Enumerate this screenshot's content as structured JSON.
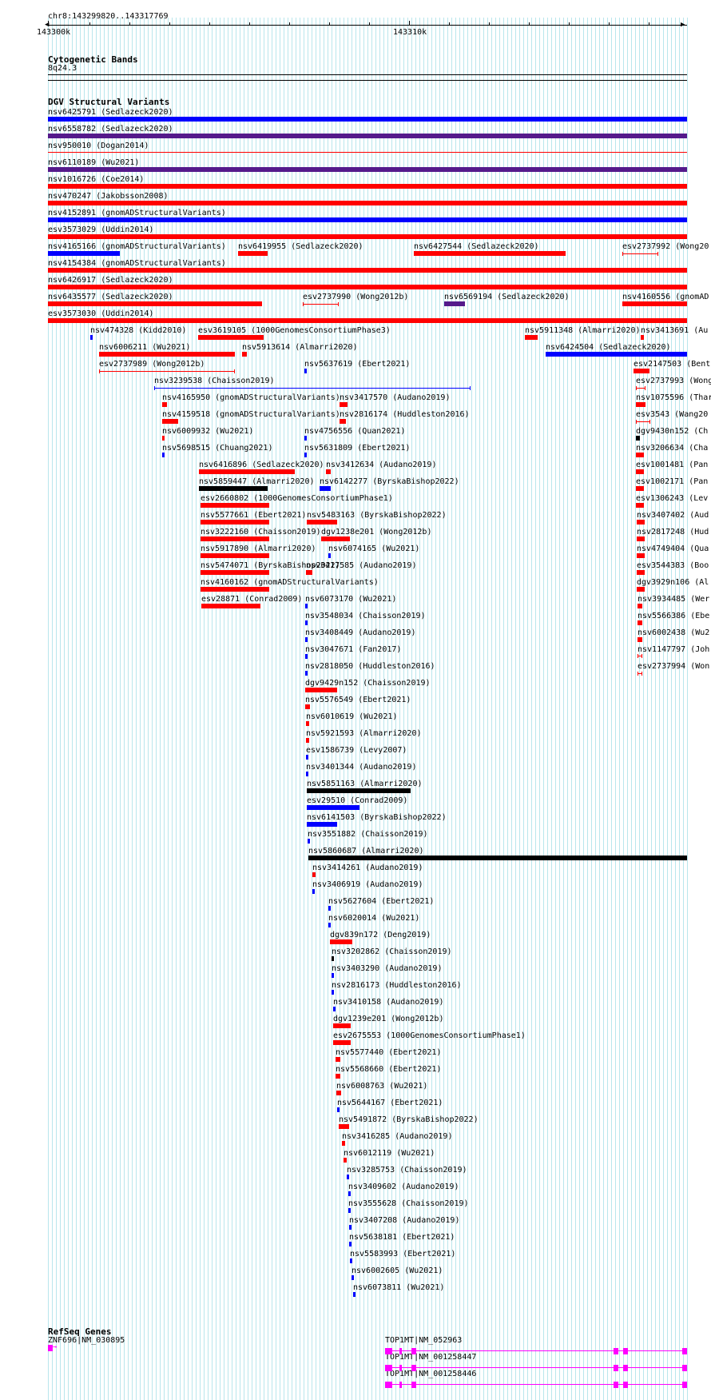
{
  "header": {
    "location": "chr8:143299820..143317769",
    "ruler_left": "143300k",
    "ruler_mid": "143310k"
  },
  "tracks": {
    "cytoband": {
      "title": "Cytogenetic Bands",
      "band": "8q24.3"
    },
    "dgv": {
      "title": "DGV Structural Variants"
    },
    "refseq": {
      "title": "RefSeq Genes"
    }
  },
  "colors": {
    "loss": "#ff0000",
    "gain": "#0000ff",
    "gain_loss": "#551a8b",
    "complex": "#000000",
    "gene": "#ff00ff",
    "grid": "#b9e6ec"
  },
  "variants": [
    {
      "label": "nsv6425791 (Sedlazeck2020)",
      "color": "#0000ff"
    },
    {
      "label": "nsv6558782 (Sedlazeck2020)",
      "color": "#551a8b"
    },
    {
      "label": "nsv950010 (Dogan2014)",
      "color": "#ff0000"
    },
    {
      "label": "nsv6110189 (Wu2021)",
      "color": "#551a8b"
    },
    {
      "label": "nsv1016726 (Coe2014)",
      "color": "#ff0000"
    },
    {
      "label": "nsv470247 (Jakobsson2008)",
      "color": "#ff0000"
    },
    {
      "label": "nsv4152891 (gnomADStructuralVariants)",
      "color": "#0000ff"
    },
    {
      "label": "esv3573029 (Uddin2014)",
      "color": "#ff0000"
    },
    {
      "label": "nsv4165166 (gnomADStructuralVariants)",
      "color": "#0000ff"
    },
    {
      "label": "nsv6419955 (Sedlazeck2020)",
      "color": "#ff0000"
    },
    {
      "label": "nsv6427544 (Sedlazeck2020)",
      "color": "#ff0000"
    },
    {
      "label": "esv2737992 (Wong20",
      "color": "#ff0000"
    },
    {
      "label": "nsv4154384 (gnomADStructuralVariants)",
      "color": "#ff0000"
    },
    {
      "label": "nsv6426917 (Sedlazeck2020)",
      "color": "#ff0000"
    },
    {
      "label": "nsv6435577 (Sedlazeck2020)",
      "color": "#ff0000"
    },
    {
      "label": "esv2737990 (Wong2012b)",
      "color": "#ff0000"
    },
    {
      "label": "nsv6569194 (Sedlazeck2020)",
      "color": "#551a8b"
    },
    {
      "label": "nsv4160556 (gnomAD",
      "color": "#ff0000"
    },
    {
      "label": "esv3573030 (Uddin2014)",
      "color": "#ff0000"
    },
    {
      "label": "nsv474328 (Kidd2010)",
      "color": "#0000ff"
    },
    {
      "label": "esv3619105 (1000GenomesConsortiumPhase3)",
      "color": "#ff0000"
    },
    {
      "label": "nsv5911348 (Almarri2020)",
      "color": "#ff0000"
    },
    {
      "label": "nsv3413691 (Au",
      "color": "#ff0000"
    },
    {
      "label": "nsv6006211 (Wu2021)",
      "color": "#ff0000"
    },
    {
      "label": "nsv5913614 (Almarri2020)",
      "color": "#ff0000"
    },
    {
      "label": "nsv6424504 (Sedlazeck2020)",
      "color": "#0000ff"
    },
    {
      "label": "esv2737989 (Wong2012b)",
      "color": "#ff0000"
    },
    {
      "label": "nsv5637619 (Ebert2021)",
      "color": "#0000ff"
    },
    {
      "label": "esv2147503 (Bent",
      "color": "#ff0000"
    },
    {
      "label": "nsv3239538 (Chaisson2019)",
      "color": "#0000ff"
    },
    {
      "label": "esv2737993 (Wong",
      "color": "#ff0000"
    },
    {
      "label": "nsv4165950 (gnomADStructuralVariants)",
      "color": "#ff0000"
    },
    {
      "label": "nsv3417570 (Audano2019)",
      "color": "#ff0000"
    },
    {
      "label": "nsv1075596 (Thar",
      "color": "#ff0000"
    },
    {
      "label": "nsv4159518 (gnomADStructuralVariants)",
      "color": "#ff0000"
    },
    {
      "label": "nsv2816174 (Huddleston2016)",
      "color": "#ff0000"
    },
    {
      "label": "esv3543 (Wang20",
      "color": "#ff0000"
    },
    {
      "label": "nsv6009932 (Wu2021)",
      "color": "#ff0000"
    },
    {
      "label": "nsv4756556 (Quan2021)",
      "color": "#0000ff"
    },
    {
      "label": "dgv9430n152 (Ch",
      "color": "#000000"
    },
    {
      "label": "nsv5698515 (Chuang2021)",
      "color": "#0000ff"
    },
    {
      "label": "nsv5631809 (Ebert2021)",
      "color": "#0000ff"
    },
    {
      "label": "nsv3206634 (Cha",
      "color": "#ff0000"
    },
    {
      "label": "nsv6416896 (Sedlazeck2020)",
      "color": "#ff0000"
    },
    {
      "label": "nsv3412634 (Audano2019)",
      "color": "#ff0000"
    },
    {
      "label": "esv1001481 (Pan",
      "color": "#ff0000"
    },
    {
      "label": "nsv5859447 (Almarri2020)",
      "color": "#000000"
    },
    {
      "label": "nsv6142277 (ByrskaBishop2022)",
      "color": "#0000ff"
    },
    {
      "label": "esv1002171 (Pan",
      "color": "#ff0000"
    },
    {
      "label": "esv2660802 (1000GenomesConsortiumPhase1)",
      "color": "#ff0000"
    },
    {
      "label": "esv1306243 (Lev",
      "color": "#ff0000"
    },
    {
      "label": "nsv5577661 (Ebert2021)",
      "color": "#ff0000"
    },
    {
      "label": "nsv5483163 (ByrskaBishop2022)",
      "color": "#ff0000"
    },
    {
      "label": "nsv3407402 (Aud",
      "color": "#ff0000"
    },
    {
      "label": "nsv3222160 (Chaisson2019)",
      "color": "#ff0000"
    },
    {
      "label": "dgv1238e201 (Wong2012b)",
      "color": "#ff0000"
    },
    {
      "label": "nsv2817248 (Hud",
      "color": "#ff0000"
    },
    {
      "label": "nsv5917890 (Almarri2020)",
      "color": "#ff0000"
    },
    {
      "label": "nsv6074165 (Wu2021)",
      "color": "#0000ff"
    },
    {
      "label": "nsv4749404 (Qua",
      "color": "#ff0000"
    },
    {
      "label": "nsv5474071 (ByrskaBishop2022)",
      "color": "#ff0000"
    },
    {
      "label": "nsv3417585 (Audano2019)",
      "color": "#ff0000"
    },
    {
      "label": "esv3544383 (Boo",
      "color": "#ff0000"
    },
    {
      "label": "nsv4160162 (gnomADStructuralVariants)",
      "color": "#ff0000"
    },
    {
      "label": "dgv3929n106 (Al",
      "color": "#ff0000"
    },
    {
      "label": "esv28871 (Conrad2009)",
      "color": "#ff0000"
    },
    {
      "label": "nsv6073170 (Wu2021)",
      "color": "#0000ff"
    },
    {
      "label": "nsv3934485 (Wer",
      "color": "#ff0000"
    },
    {
      "label": "nsv3548034 (Chaisson2019)",
      "color": "#0000ff"
    },
    {
      "label": "nsv5566386 (Ebe",
      "color": "#ff0000"
    },
    {
      "label": "nsv3408449 (Audano2019)",
      "color": "#0000ff"
    },
    {
      "label": "nsv6002438 (Wu2",
      "color": "#ff0000"
    },
    {
      "label": "nsv3047671 (Fan2017)",
      "color": "#0000ff"
    },
    {
      "label": "nsv1147797 (Joh",
      "color": "#ff0000"
    },
    {
      "label": "nsv2818050 (Huddleston2016)",
      "color": "#0000ff"
    },
    {
      "label": "esv2737994 (Won",
      "color": "#ff0000"
    },
    {
      "label": "dgv9429n152 (Chaisson2019)",
      "color": "#ff0000"
    },
    {
      "label": "nsv5576549 (Ebert2021)",
      "color": "#ff0000"
    },
    {
      "label": "nsv6010619 (Wu2021)",
      "color": "#ff0000"
    },
    {
      "label": "nsv5921593 (Almarri2020)",
      "color": "#ff0000"
    },
    {
      "label": "esv1586739 (Levy2007)",
      "color": "#0000ff"
    },
    {
      "label": "nsv3401344 (Audano2019)",
      "color": "#0000ff"
    },
    {
      "label": "nsv5851163 (Almarri2020)",
      "color": "#000000"
    },
    {
      "label": "esv29510 (Conrad2009)",
      "color": "#0000ff"
    },
    {
      "label": "nsv6141503 (ByrskaBishop2022)",
      "color": "#0000ff"
    },
    {
      "label": "nsv3551882 (Chaisson2019)",
      "color": "#0000ff"
    },
    {
      "label": "nsv5860687 (Almarri2020)",
      "color": "#000000"
    },
    {
      "label": "nsv3414261 (Audano2019)",
      "color": "#ff0000"
    },
    {
      "label": "nsv3406919 (Audano2019)",
      "color": "#0000ff"
    },
    {
      "label": "nsv5627604 (Ebert2021)",
      "color": "#0000ff"
    },
    {
      "label": "nsv6020014 (Wu2021)",
      "color": "#0000ff"
    },
    {
      "label": "dgv839n172 (Deng2019)",
      "color": "#ff0000"
    },
    {
      "label": "nsv3202862 (Chaisson2019)",
      "color": "#000000"
    },
    {
      "label": "nsv3403290 (Audano2019)",
      "color": "#0000ff"
    },
    {
      "label": "nsv2816173 (Huddleston2016)",
      "color": "#0000ff"
    },
    {
      "label": "nsv3410158 (Audano2019)",
      "color": "#0000ff"
    },
    {
      "label": "dgv1239e201 (Wong2012b)",
      "color": "#ff0000"
    },
    {
      "label": "esv2675553 (1000GenomesConsortiumPhase1)",
      "color": "#ff0000"
    },
    {
      "label": "nsv5577440 (Ebert2021)",
      "color": "#ff0000"
    },
    {
      "label": "nsv5568660 (Ebert2021)",
      "color": "#ff0000"
    },
    {
      "label": "nsv6008763 (Wu2021)",
      "color": "#ff0000"
    },
    {
      "label": "nsv5644167 (Ebert2021)",
      "color": "#0000ff"
    },
    {
      "label": "nsv5491872 (ByrskaBishop2022)",
      "color": "#ff0000"
    },
    {
      "label": "nsv3416285 (Audano2019)",
      "color": "#ff0000"
    },
    {
      "label": "nsv6012119 (Wu2021)",
      "color": "#ff0000"
    },
    {
      "label": "nsv3285753 (Chaisson2019)",
      "color": "#0000ff"
    },
    {
      "label": "nsv3409602 (Audano2019)",
      "color": "#0000ff"
    },
    {
      "label": "nsv3555628 (Chaisson2019)",
      "color": "#0000ff"
    },
    {
      "label": "nsv3407208 (Audano2019)",
      "color": "#0000ff"
    },
    {
      "label": "nsv5638181 (Ebert2021)",
      "color": "#0000ff"
    },
    {
      "label": "nsv5583993 (Ebert2021)",
      "color": "#0000ff"
    },
    {
      "label": "nsv6002605 (Wu2021)",
      "color": "#0000ff"
    },
    {
      "label": "nsv6073811 (Wu2021)",
      "color": "#0000ff"
    }
  ],
  "genes": [
    {
      "label": "ZNF696|NM_030895"
    },
    {
      "label": "TOP1MT|NM_052963"
    },
    {
      "label": "TOP1MT|NM_001258447"
    },
    {
      "label": "TOP1MT|NM_001258446"
    }
  ]
}
